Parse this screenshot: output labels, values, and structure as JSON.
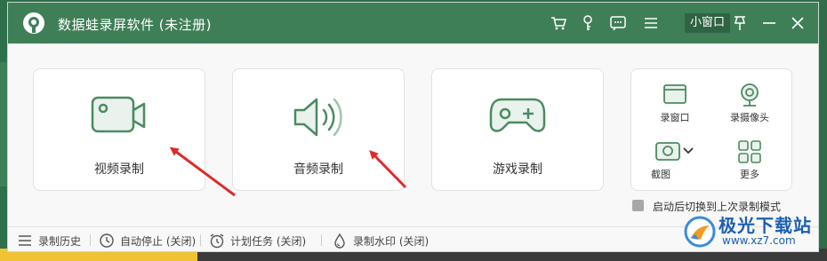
{
  "window": {
    "title": "数据蛙录屏软件 (未注册)",
    "mini_window_label": "小窗口",
    "titlebar_icons": [
      "cart-icon",
      "key-icon",
      "message-icon",
      "menu-icon",
      "pin-icon",
      "minimize-icon",
      "close-icon"
    ]
  },
  "cards": [
    {
      "label": "视频录制",
      "icon": "video-camera-icon"
    },
    {
      "label": "音频录制",
      "icon": "speaker-icon"
    },
    {
      "label": "游戏录制",
      "icon": "gamepad-icon"
    }
  ],
  "tools": [
    {
      "label": "录窗口",
      "icon": "window-icon"
    },
    {
      "label": "录摄像头",
      "icon": "webcam-icon"
    },
    {
      "label": "截图",
      "icon": "screenshot-icon"
    },
    {
      "label": "更多",
      "icon": "grid-icon"
    }
  ],
  "option": {
    "label": "启动后切换到上次录制模式",
    "checked": false
  },
  "footer": {
    "history": "录制历史",
    "auto_stop": "自动停止 (关闭)",
    "schedule": "计划任务 (关闭)",
    "watermark": "录制水印 (关闭)"
  },
  "site_watermark": {
    "name": "极光下载站",
    "url": "www.xz7.com"
  },
  "colors": {
    "brand": "#3f7f57",
    "accent_green": "#4b8a61",
    "arrow_red": "#e02a2a"
  }
}
